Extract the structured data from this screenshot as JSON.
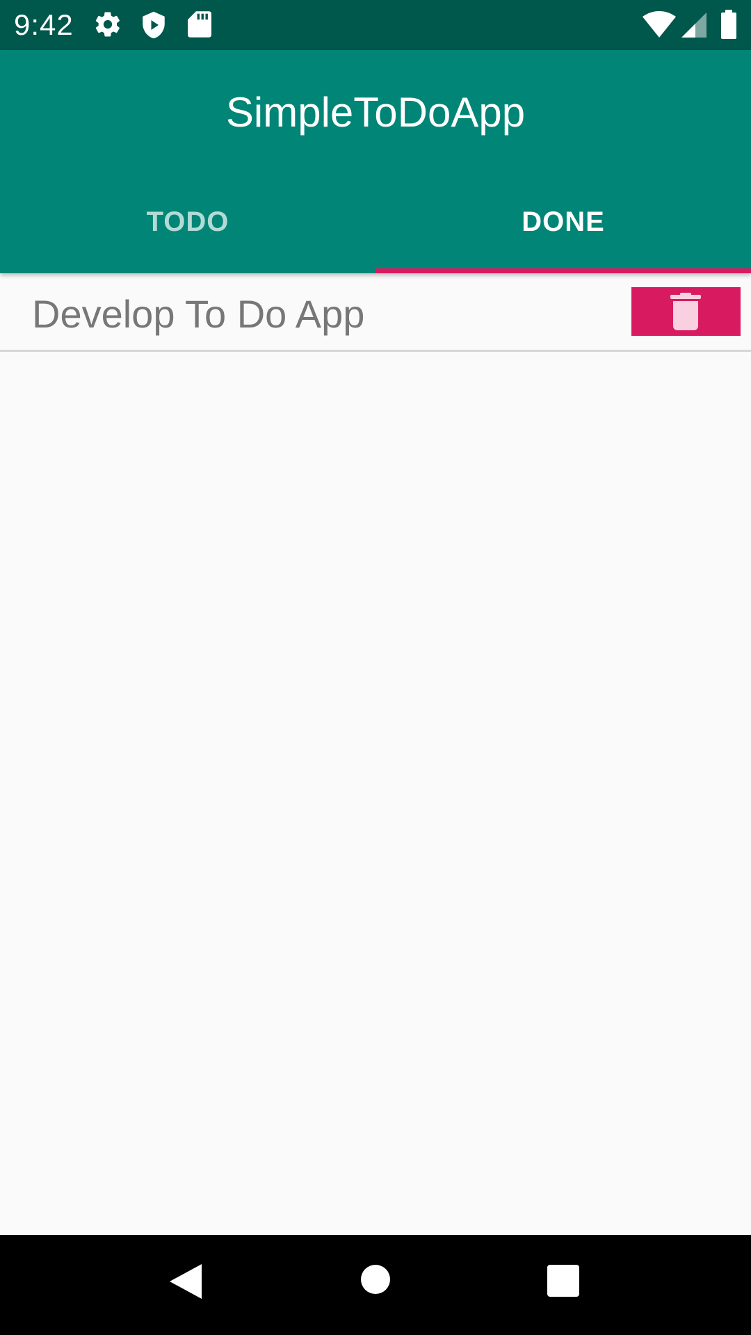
{
  "status_bar": {
    "time": "9:42",
    "icons_left": [
      "gear-icon",
      "shield-play-icon",
      "sd-card-icon"
    ],
    "icons_right": [
      "wifi-icon",
      "cell-signal-icon",
      "battery-icon"
    ]
  },
  "app_bar": {
    "title": "SimpleToDoApp",
    "color": "#008577"
  },
  "tabs": [
    {
      "label": "TODO",
      "selected": false
    },
    {
      "label": "DONE",
      "selected": true
    }
  ],
  "accent_color": "#d81b60",
  "done_list": [
    {
      "text": "Develop To Do App",
      "action_icon": "trash-icon"
    }
  ],
  "nav_bar": {
    "buttons": [
      "back-icon",
      "home-icon",
      "recents-icon"
    ]
  }
}
